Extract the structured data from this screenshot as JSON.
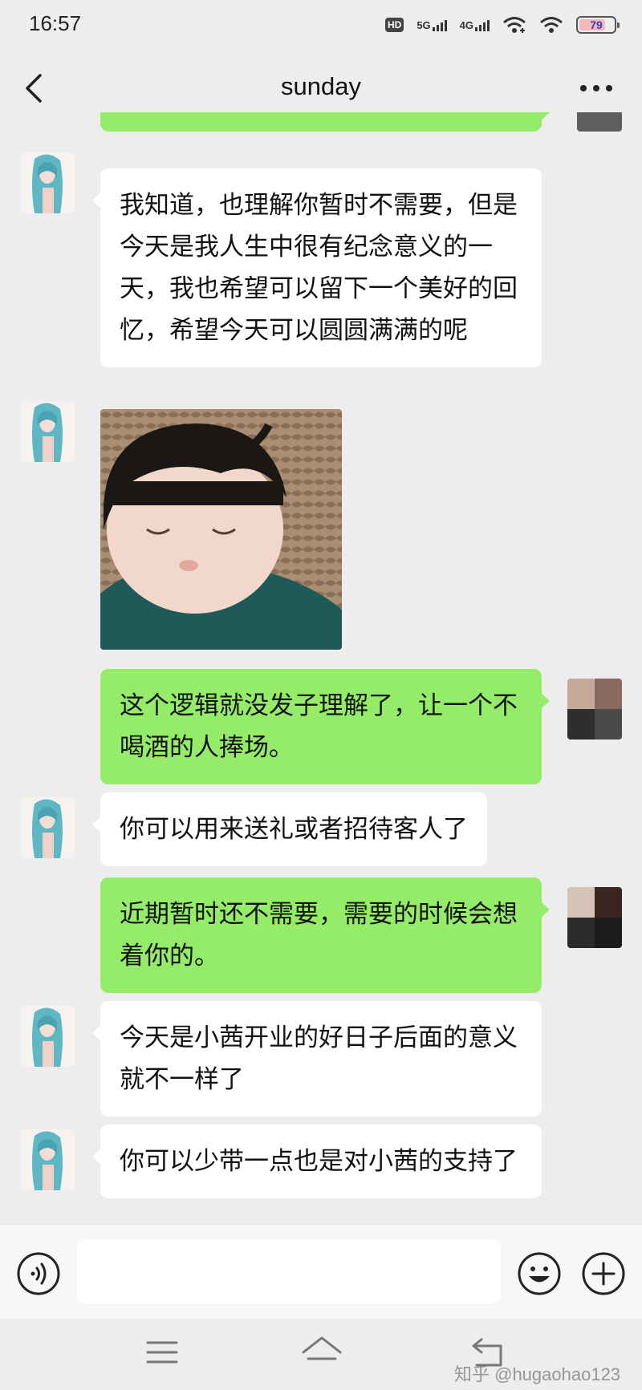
{
  "status_bar": {
    "time": "16:57",
    "network_hd": "HD",
    "network_5g": "5G",
    "network_4g": "4G",
    "battery": "79"
  },
  "header": {
    "title": "sunday"
  },
  "messages": [
    {
      "side": "left",
      "type": "text",
      "text": "我知道，也理解你暂时不需要，但是今天是我人生中很有纪念意义的一天，我也希望可以留下一个美好的回忆，希望今天可以圆圆满满的呢"
    },
    {
      "side": "left",
      "type": "image",
      "alt": "baby sticker"
    },
    {
      "side": "right",
      "type": "text",
      "text": "这个逻辑就没发子理解了，让一个不喝酒的人捧场。"
    },
    {
      "side": "left",
      "type": "text",
      "text": "你可以用来送礼或者招待客人了"
    },
    {
      "side": "right",
      "type": "text",
      "text": "近期暂时还不需要，需要的时候会想着你的。"
    },
    {
      "side": "left",
      "type": "text",
      "text": "今天是小茜开业的好日子后面的意义就不一样了"
    },
    {
      "side": "left",
      "type": "text",
      "text": "你可以少带一点也是对小茜的支持了"
    }
  ],
  "input": {
    "value": ""
  },
  "watermark": "知乎 @hugaohao123",
  "colors": {
    "background": "#ededed",
    "bubble_self": "#95ec69",
    "bubble_other": "#ffffff"
  }
}
